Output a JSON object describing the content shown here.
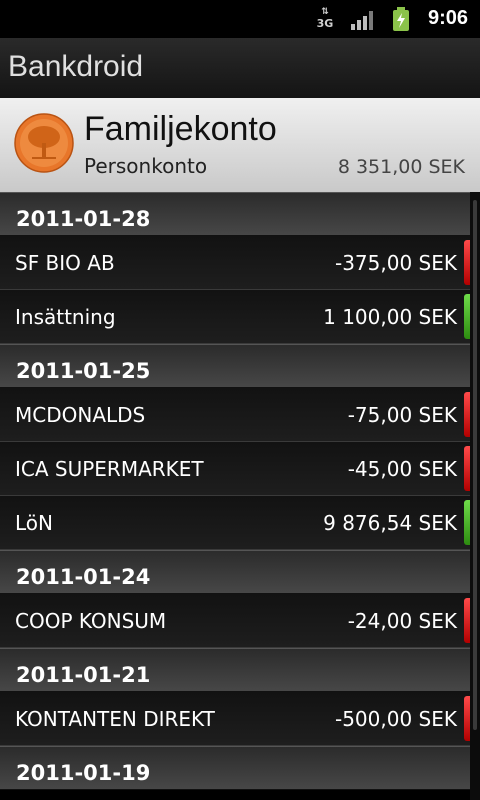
{
  "status_bar": {
    "network": "3G",
    "time": "9:06"
  },
  "app": {
    "title": "Bankdroid"
  },
  "account": {
    "name": "Familjekonto",
    "type": "Personkonto",
    "balance": "8 351,00 SEK"
  },
  "groups": [
    {
      "date": "2011-01-28",
      "transactions": [
        {
          "description": "SF BIO AB",
          "amount": "-375,00 SEK",
          "kind": "neg"
        },
        {
          "description": "Insättning",
          "amount": "1 100,00 SEK",
          "kind": "pos"
        }
      ]
    },
    {
      "date": "2011-01-25",
      "transactions": [
        {
          "description": "MCDONALDS",
          "amount": "-75,00 SEK",
          "kind": "neg"
        },
        {
          "description": "ICA SUPERMARKET",
          "amount": "-45,00 SEK",
          "kind": "neg"
        },
        {
          "description": "LöN",
          "amount": "9 876,54 SEK",
          "kind": "pos"
        }
      ]
    },
    {
      "date": "2011-01-24",
      "transactions": [
        {
          "description": "COOP KONSUM",
          "amount": "-24,00 SEK",
          "kind": "neg"
        }
      ]
    },
    {
      "date": "2011-01-21",
      "transactions": [
        {
          "description": "KONTANTEN DIREKT",
          "amount": "-500,00 SEK",
          "kind": "neg"
        }
      ]
    },
    {
      "date": "2011-01-19",
      "transactions": []
    }
  ],
  "colors": {
    "negative": "#e01a1a",
    "positive": "#4cb82a",
    "header_bg": "#d9d9d9"
  },
  "icons": {
    "bank_logo": "tree-seal-icon",
    "signal": "signal-bars-icon",
    "battery": "battery-charging-icon"
  }
}
